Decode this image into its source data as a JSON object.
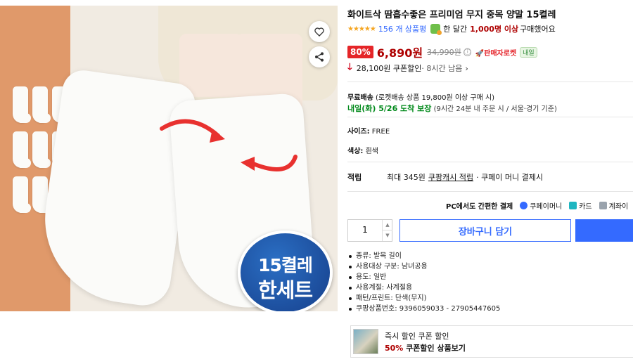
{
  "product": {
    "title": "화이트삭 땀흡수좋은 프리미엄 무지 중목 양말 15켤레",
    "rating_stars": "★★★★★",
    "review_count": "156 개 상품평",
    "buyers_prefix": "한 달간",
    "buyers_count": "1,000명 이상",
    "buyers_suffix": "구매했어요",
    "discount_rate": "80%",
    "sale_price": "6,890원",
    "original_price": "34,990원",
    "info_icon": "ⓘ",
    "rocket_label": "🚀판매자로켓",
    "tomorrow_chip": "내일",
    "coupon_amount": "28,100원 쿠폰할인",
    "coupon_time": "· 8시간 남음",
    "chevron": "›",
    "badge_line1": "15켤레",
    "badge_line2": "한세트"
  },
  "shipping": {
    "label": "무료배송",
    "condition": "(로켓배송 상품 19,800원 이상 구매 시)",
    "eta": "내일(화) 5/26 도착 보장",
    "eta_note": "(9시간 24분 내 주문 시 / 서울·경기 기준)"
  },
  "options": {
    "size_label": "사이즈:",
    "size_value": "FREE",
    "color_label": "색상:",
    "color_value": "흰색"
  },
  "points": {
    "label": "적립",
    "text_before": "최대 345원",
    "link": "쿠팡캐시 적립",
    "text_after": "· 쿠페이 머니 결제시"
  },
  "payment": {
    "pc_label": "PC에서도 간편한 결제",
    "methods": [
      "쿠페이머니",
      "카드",
      "계좌이"
    ]
  },
  "purchase": {
    "quantity": "1",
    "up": "▲",
    "down": "▼",
    "cart_label": "장바구니 담기"
  },
  "specs": [
    "종류: 발목 길이",
    "사용대상 구분: 남녀공용",
    "용도: 일반",
    "사용계절: 사계절용",
    "패턴/프린트: 단색(무지)",
    "쿠팡상품번호: 9396059033 - 27905447605"
  ],
  "banner": {
    "line1": "즉시 할인 쿠폰 할인",
    "percent": "50%",
    "line2_rest": "쿠폰할인 상품보기"
  },
  "colors": {
    "accent_blue": "#346aff",
    "price_red": "#ae0000",
    "badge_red": "#e52528",
    "arrival_green": "#00891a"
  },
  "icons": [
    "heart-icon",
    "share-icon",
    "info-icon",
    "down-arrow-icon",
    "kupay-icon",
    "card-icon",
    "bank-icon"
  ]
}
